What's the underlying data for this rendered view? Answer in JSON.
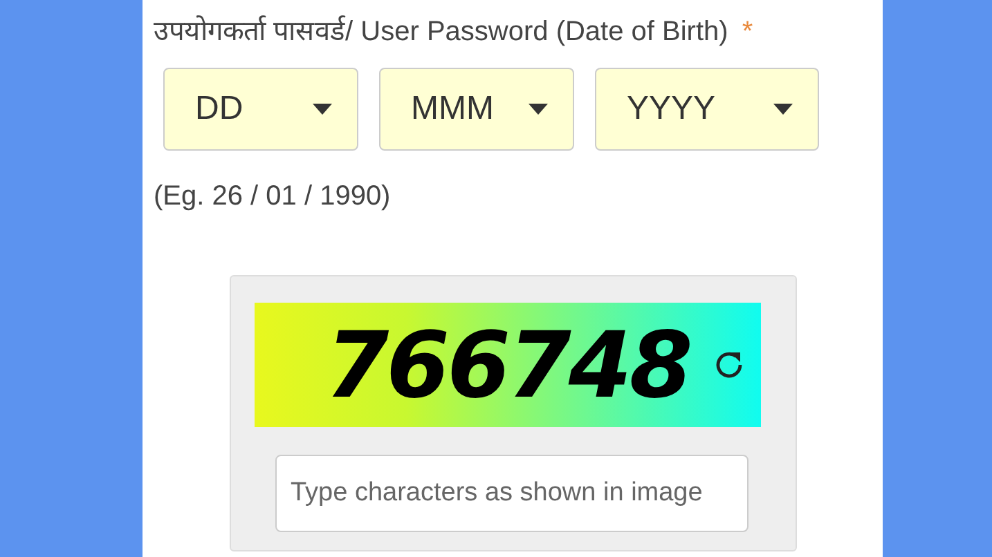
{
  "field_label": {
    "text": "उपयोगकर्ता पासवर्ड/ User Password (Date of Birth)",
    "required_mark": "*"
  },
  "dropdowns": [
    {
      "value": "DD"
    },
    {
      "value": "MMM"
    },
    {
      "value": "YYYY"
    }
  ],
  "example": "(Eg. 26 / 01 / 1990)",
  "captcha": {
    "code": "766748",
    "input": {
      "placeholder": "Type characters as shown in image"
    }
  }
}
